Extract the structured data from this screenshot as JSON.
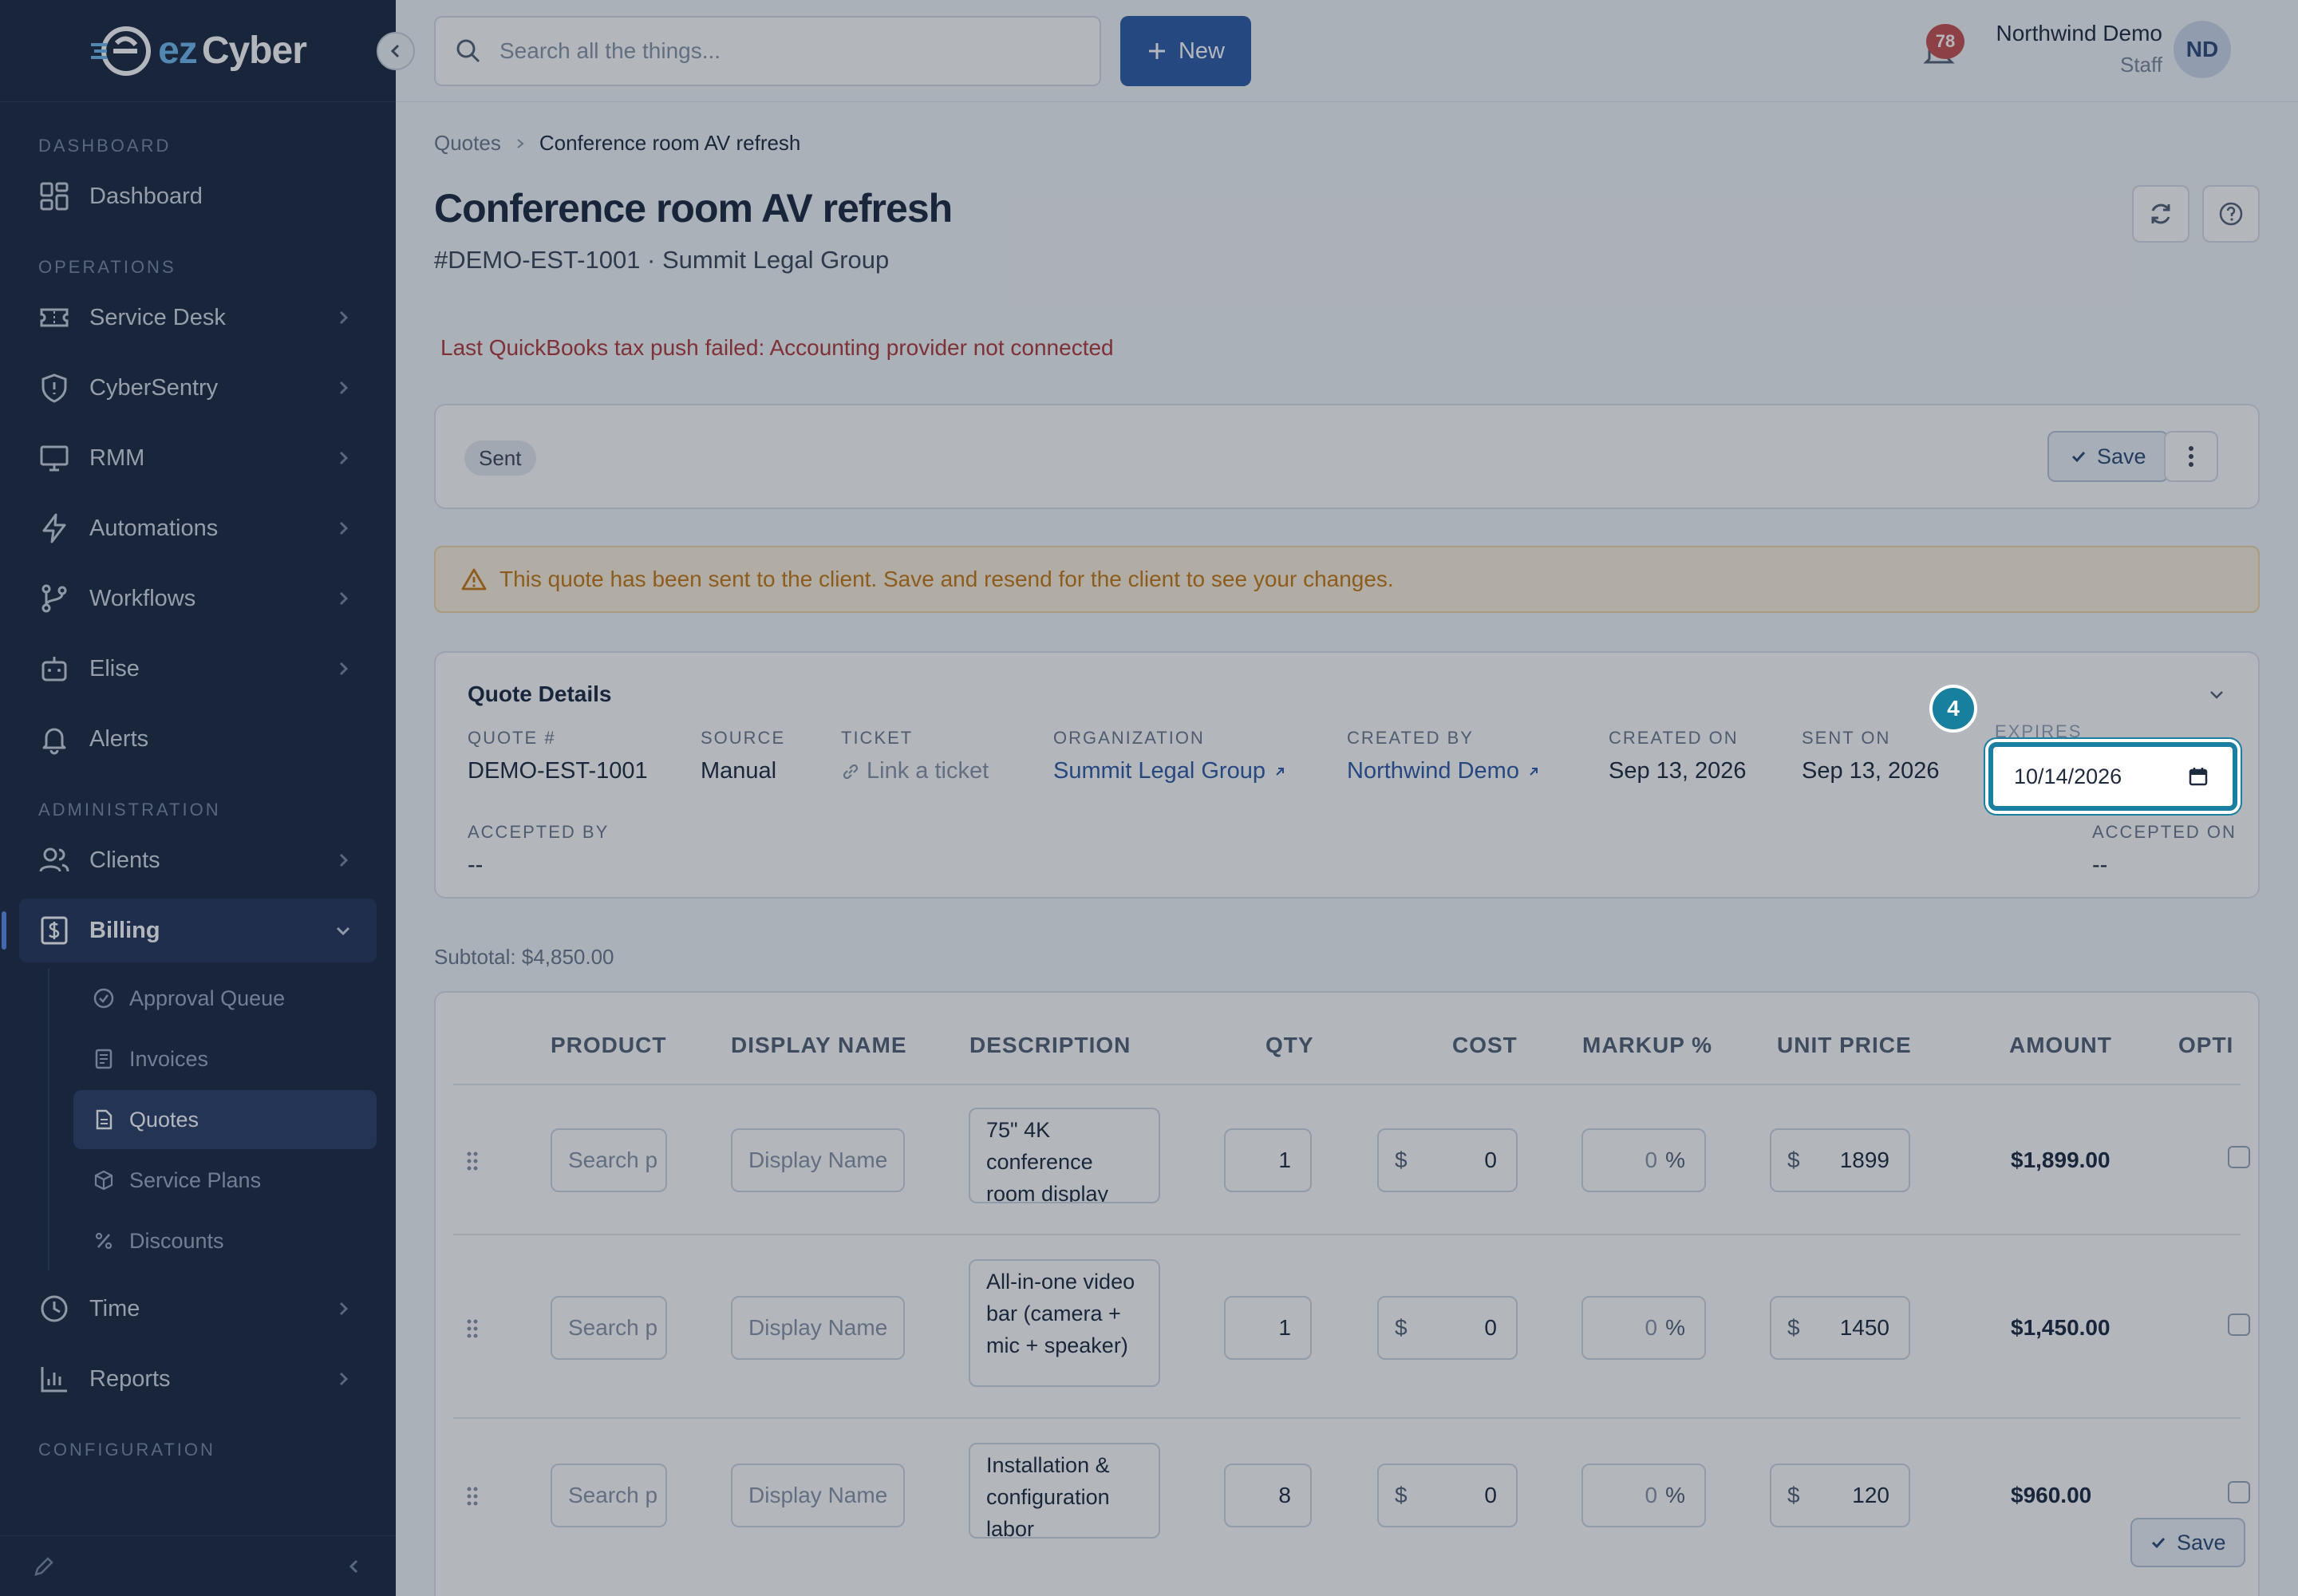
{
  "app": {
    "logo_text_1": "ez",
    "logo_text_2": "Cyber"
  },
  "sidebar": {
    "sections": {
      "dashboard": "DASHBOARD",
      "operations": "OPERATIONS",
      "administration": "ADMINISTRATION",
      "configuration": "CONFIGURATION"
    },
    "items": {
      "dashboard": "Dashboard",
      "service_desk": "Service Desk",
      "cybersentry": "CyberSentry",
      "rmm": "RMM",
      "automations": "Automations",
      "workflows": "Workflows",
      "elise": "Elise",
      "alerts": "Alerts",
      "clients": "Clients",
      "billing": "Billing",
      "time": "Time",
      "reports": "Reports"
    },
    "billing_sub": {
      "approval_queue": "Approval Queue",
      "invoices": "Invoices",
      "quotes": "Quotes",
      "service_plans": "Service Plans",
      "discounts": "Discounts"
    }
  },
  "topbar": {
    "search_placeholder": "Search all the things...",
    "new_label": "New",
    "notifications_count": "78",
    "user_name": "Northwind Demo",
    "user_role": "Staff",
    "avatar_initials": "ND"
  },
  "breadcrumb": {
    "parent": "Quotes",
    "current": "Conference room AV refresh"
  },
  "page": {
    "title": "Conference room AV refresh",
    "subtitle": "#DEMO-EST-1001 · Summit Legal Group",
    "error": "Last QuickBooks tax push failed: Accounting provider not connected",
    "status": "Sent",
    "save_label": "Save",
    "warning": "This quote has been sent to the client. Save and resend for the client to see your changes."
  },
  "details": {
    "heading": "Quote Details",
    "quote_num_label": "QUOTE #",
    "quote_num": "DEMO-EST-1001",
    "source_label": "SOURCE",
    "source": "Manual",
    "ticket_label": "TICKET",
    "ticket": "Link a ticket",
    "org_label": "ORGANIZATION",
    "org": "Summit Legal Group",
    "created_by_label": "CREATED BY",
    "created_by": "Northwind Demo",
    "created_on_label": "CREATED ON",
    "created_on": "Sep 13, 2026",
    "sent_on_label": "SENT ON",
    "sent_on": "Sep 13, 2026",
    "expires_label": "EXPIRES",
    "expires": "10/14/2026",
    "accepted_by_label": "ACCEPTED BY",
    "accepted_by": "--",
    "accepted_on_label": "ACCEPTED ON",
    "accepted_on": "--",
    "step_badge": "4"
  },
  "lines": {
    "subtotal": "Subtotal: $4,850.00",
    "headers": {
      "product": "PRODUCT",
      "display_name": "DISPLAY NAME",
      "description": "DESCRIPTION",
      "qty": "QTY",
      "cost": "COST",
      "markup": "MARKUP %",
      "unit_price": "UNIT PRICE",
      "amount": "AMOUNT",
      "optional": "OPTI"
    },
    "product_placeholder": "Search p",
    "display_placeholder": "Display Name",
    "currency": "$",
    "percent": "%",
    "rows": [
      {
        "description": "75\" 4K conference room display",
        "qty": "1",
        "cost": "0",
        "markup": "0",
        "unit_price": "1899",
        "amount": "$1,899.00"
      },
      {
        "description": "All-in-one video bar (camera + mic + speaker)",
        "qty": "1",
        "cost": "0",
        "markup": "0",
        "unit_price": "1450",
        "amount": "$1,450.00"
      },
      {
        "description": "Installation & configuration labor",
        "qty": "8",
        "cost": "0",
        "markup": "0",
        "unit_price": "120",
        "amount": "$960.00"
      }
    ],
    "footer_save": "Save"
  }
}
